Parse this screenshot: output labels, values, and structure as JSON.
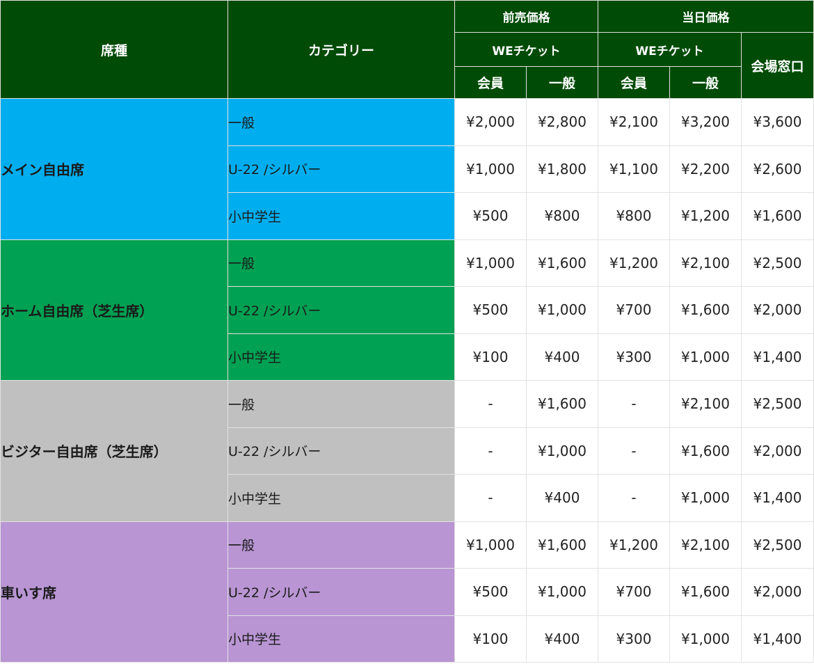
{
  "header": {
    "seat_type": "席種",
    "category": "カテゴリー",
    "advance_price": "前売価格",
    "day_price": "当日価格",
    "we_ticket_advance": "WEチケット",
    "we_ticket_day": "WEチケット",
    "venue_window": "会場窓口",
    "member_advance": "会員",
    "general_advance": "一般",
    "member_day": "会員",
    "general_day": "一般"
  },
  "colors": {
    "header_bg": "#004b06",
    "main_seat": "#00aeef",
    "home_seat": "#00a152",
    "visitor_seat": "#c0c0c0",
    "wheelchair_seat": "#b995d3"
  },
  "sections": [
    {
      "seat": "メイン自由席",
      "rows": [
        {
          "category": "一般",
          "prices": [
            "¥2,000",
            "¥2,800",
            "¥2,100",
            "¥3,200",
            "¥3,600"
          ]
        },
        {
          "category": "U-22 /シルバー",
          "prices": [
            "¥1,000",
            "¥1,800",
            "¥1,100",
            "¥2,200",
            "¥2,600"
          ]
        },
        {
          "category": "小中学生",
          "prices": [
            "¥500",
            "¥800",
            "¥800",
            "¥1,200",
            "¥1,600"
          ]
        }
      ]
    },
    {
      "seat": "ホーム自由席（芝生席）",
      "rows": [
        {
          "category": "一般",
          "prices": [
            "¥1,000",
            "¥1,600",
            "¥1,200",
            "¥2,100",
            "¥2,500"
          ]
        },
        {
          "category": "U-22 /シルバー",
          "prices": [
            "¥500",
            "¥1,000",
            "¥700",
            "¥1,600",
            "¥2,000"
          ]
        },
        {
          "category": "小中学生",
          "prices": [
            "¥100",
            "¥400",
            "¥300",
            "¥1,000",
            "¥1,400"
          ]
        }
      ]
    },
    {
      "seat": "ビジター自由席（芝生席）",
      "rows": [
        {
          "category": "一般",
          "prices": [
            "-",
            "¥1,600",
            "-",
            "¥2,100",
            "¥2,500"
          ]
        },
        {
          "category": "U-22 /シルバー",
          "prices": [
            "-",
            "¥1,000",
            "-",
            "¥1,600",
            "¥2,000"
          ]
        },
        {
          "category": "小中学生",
          "prices": [
            "-",
            "¥400",
            "-",
            "¥1,000",
            "¥1,400"
          ]
        }
      ]
    },
    {
      "seat": "車いす席",
      "rows": [
        {
          "category": "一般",
          "prices": [
            "¥1,000",
            "¥1,600",
            "¥1,200",
            "¥2,100",
            "¥2,500"
          ]
        },
        {
          "category": "U-22 /シルバー",
          "prices": [
            "¥500",
            "¥1,000",
            "¥700",
            "¥1,600",
            "¥2,000"
          ]
        },
        {
          "category": "小中学生",
          "prices": [
            "¥100",
            "¥400",
            "¥300",
            "¥1,000",
            "¥1,400"
          ]
        }
      ]
    }
  ]
}
